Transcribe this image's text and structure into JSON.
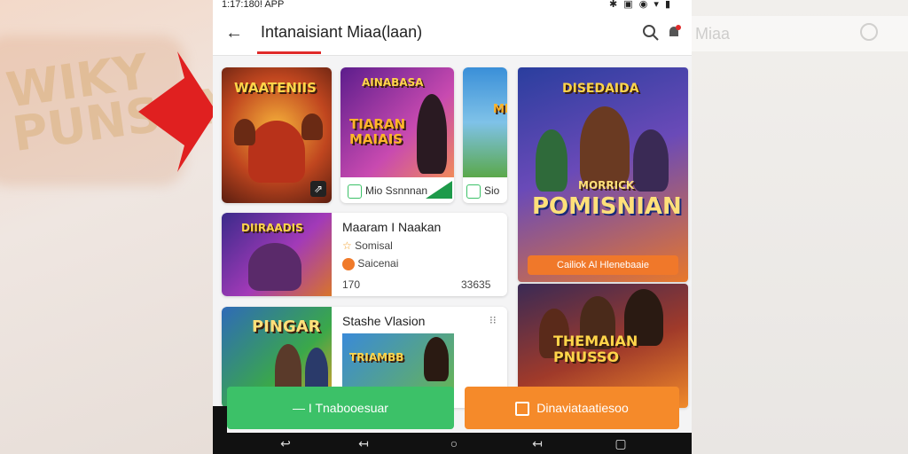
{
  "status_bar": {
    "left": "1:17:180! APP",
    "right": "✱ ▣ ◉ ▾ ▮"
  },
  "app_bar": {
    "back_icon": "arrow-left-icon",
    "title": "Intanaisiant Miaa(laan)",
    "search_icon": "search-icon",
    "notification_icon": "bell-icon"
  },
  "background": {
    "left_ghost_text": "WIKY PUNSAN",
    "right_ghost_title": "Miaa"
  },
  "grid": {
    "tile1": {
      "title": "WAATENIIS"
    },
    "tile2": {
      "title_top": "AINABASA",
      "title_main": "TIARAN MAIAIS",
      "chip_label": "Mio Ssnnnan"
    },
    "tile3": {
      "title": "MI",
      "chip_label": "Sio"
    },
    "feature": {
      "title_top": "DISEDAIDA",
      "title_main": "POMISNIAN",
      "subtitle": "MORRICK",
      "cta": "Cailiok Al Hlenebaaie"
    },
    "feature2": {
      "title": "THEMAIAN PNUSSO"
    }
  },
  "list": {
    "item1": {
      "art_title": "DIIRAADIS",
      "title": "Maaram I Naakan",
      "rating": "Somisal",
      "badge": "Saicenai",
      "left_num": "170",
      "right_num": "33635"
    },
    "item2": {
      "art_title": "PINGAR",
      "title": "Stashe Vlasion",
      "menu_icon": "more-icon",
      "sub_art_title": "TRIAMBB"
    }
  },
  "buttons": {
    "install": "Tnabooesuar",
    "install_prefix": "— I",
    "open": "Dinaviataatiesoo"
  },
  "nav": {
    "icons": [
      "back-nav-icon",
      "home-nav-icon",
      "recent-nav-icon",
      "square-nav-icon"
    ]
  },
  "colors": {
    "accent_red": "#e02a2a",
    "green_button": "#3cc168",
    "orange_button": "#f58a2a"
  }
}
